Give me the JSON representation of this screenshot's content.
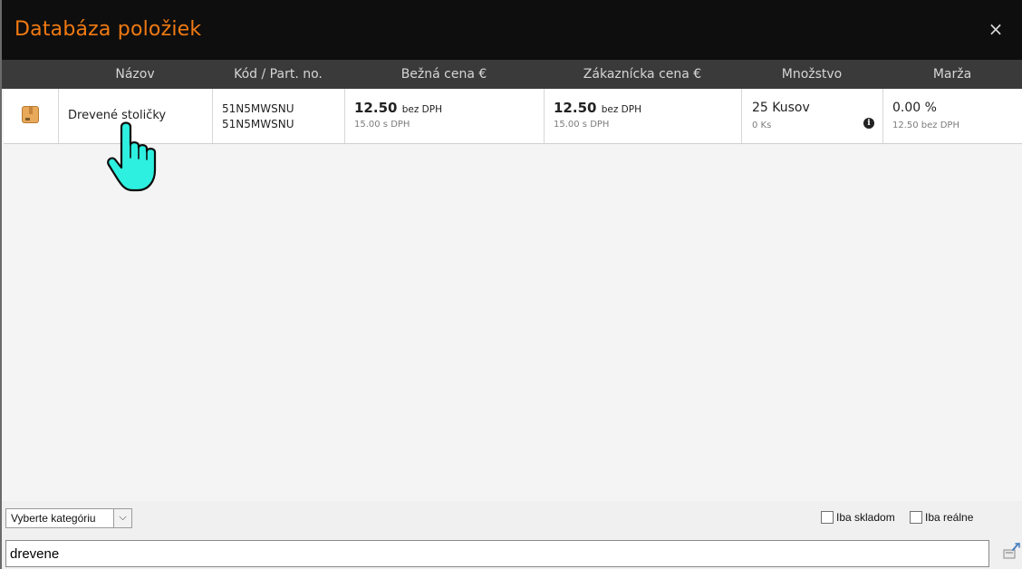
{
  "dialog": {
    "title": "Databáza položiek",
    "close_label": "×"
  },
  "table": {
    "columns": [
      "Názov",
      "Kód / Part. no.",
      "Bežná cena €",
      "Zákaznícka cena €",
      "Množstvo",
      "Marža"
    ],
    "rows": [
      {
        "icon": "package-icon",
        "name": "Drevené stoličky",
        "code": "51N5MWSNU",
        "part_no": "51N5MWSNU",
        "regular_price": "12.50",
        "regular_price_suffix": "bez DPH",
        "regular_price_vat": "15.00 s DPH",
        "customer_price": "12.50",
        "customer_price_suffix": "bez DPH",
        "customer_price_vat": "15.00 s DPH",
        "quantity": "25 Kusov",
        "quantity_sub": "0 Ks",
        "quantity_info_icon": "info-icon",
        "margin": "0.00 %",
        "margin_sub": "12.50 bez DPH"
      }
    ]
  },
  "filters": {
    "category_select": "Vyberte kategóriu",
    "only_in_stock": "Iba skladom",
    "only_real": "Iba reálne"
  },
  "search": {
    "value": "drevene"
  },
  "colors": {
    "title": "#f07a12",
    "titlebar": "#0e0e0e",
    "header": "#3a3a3a"
  }
}
